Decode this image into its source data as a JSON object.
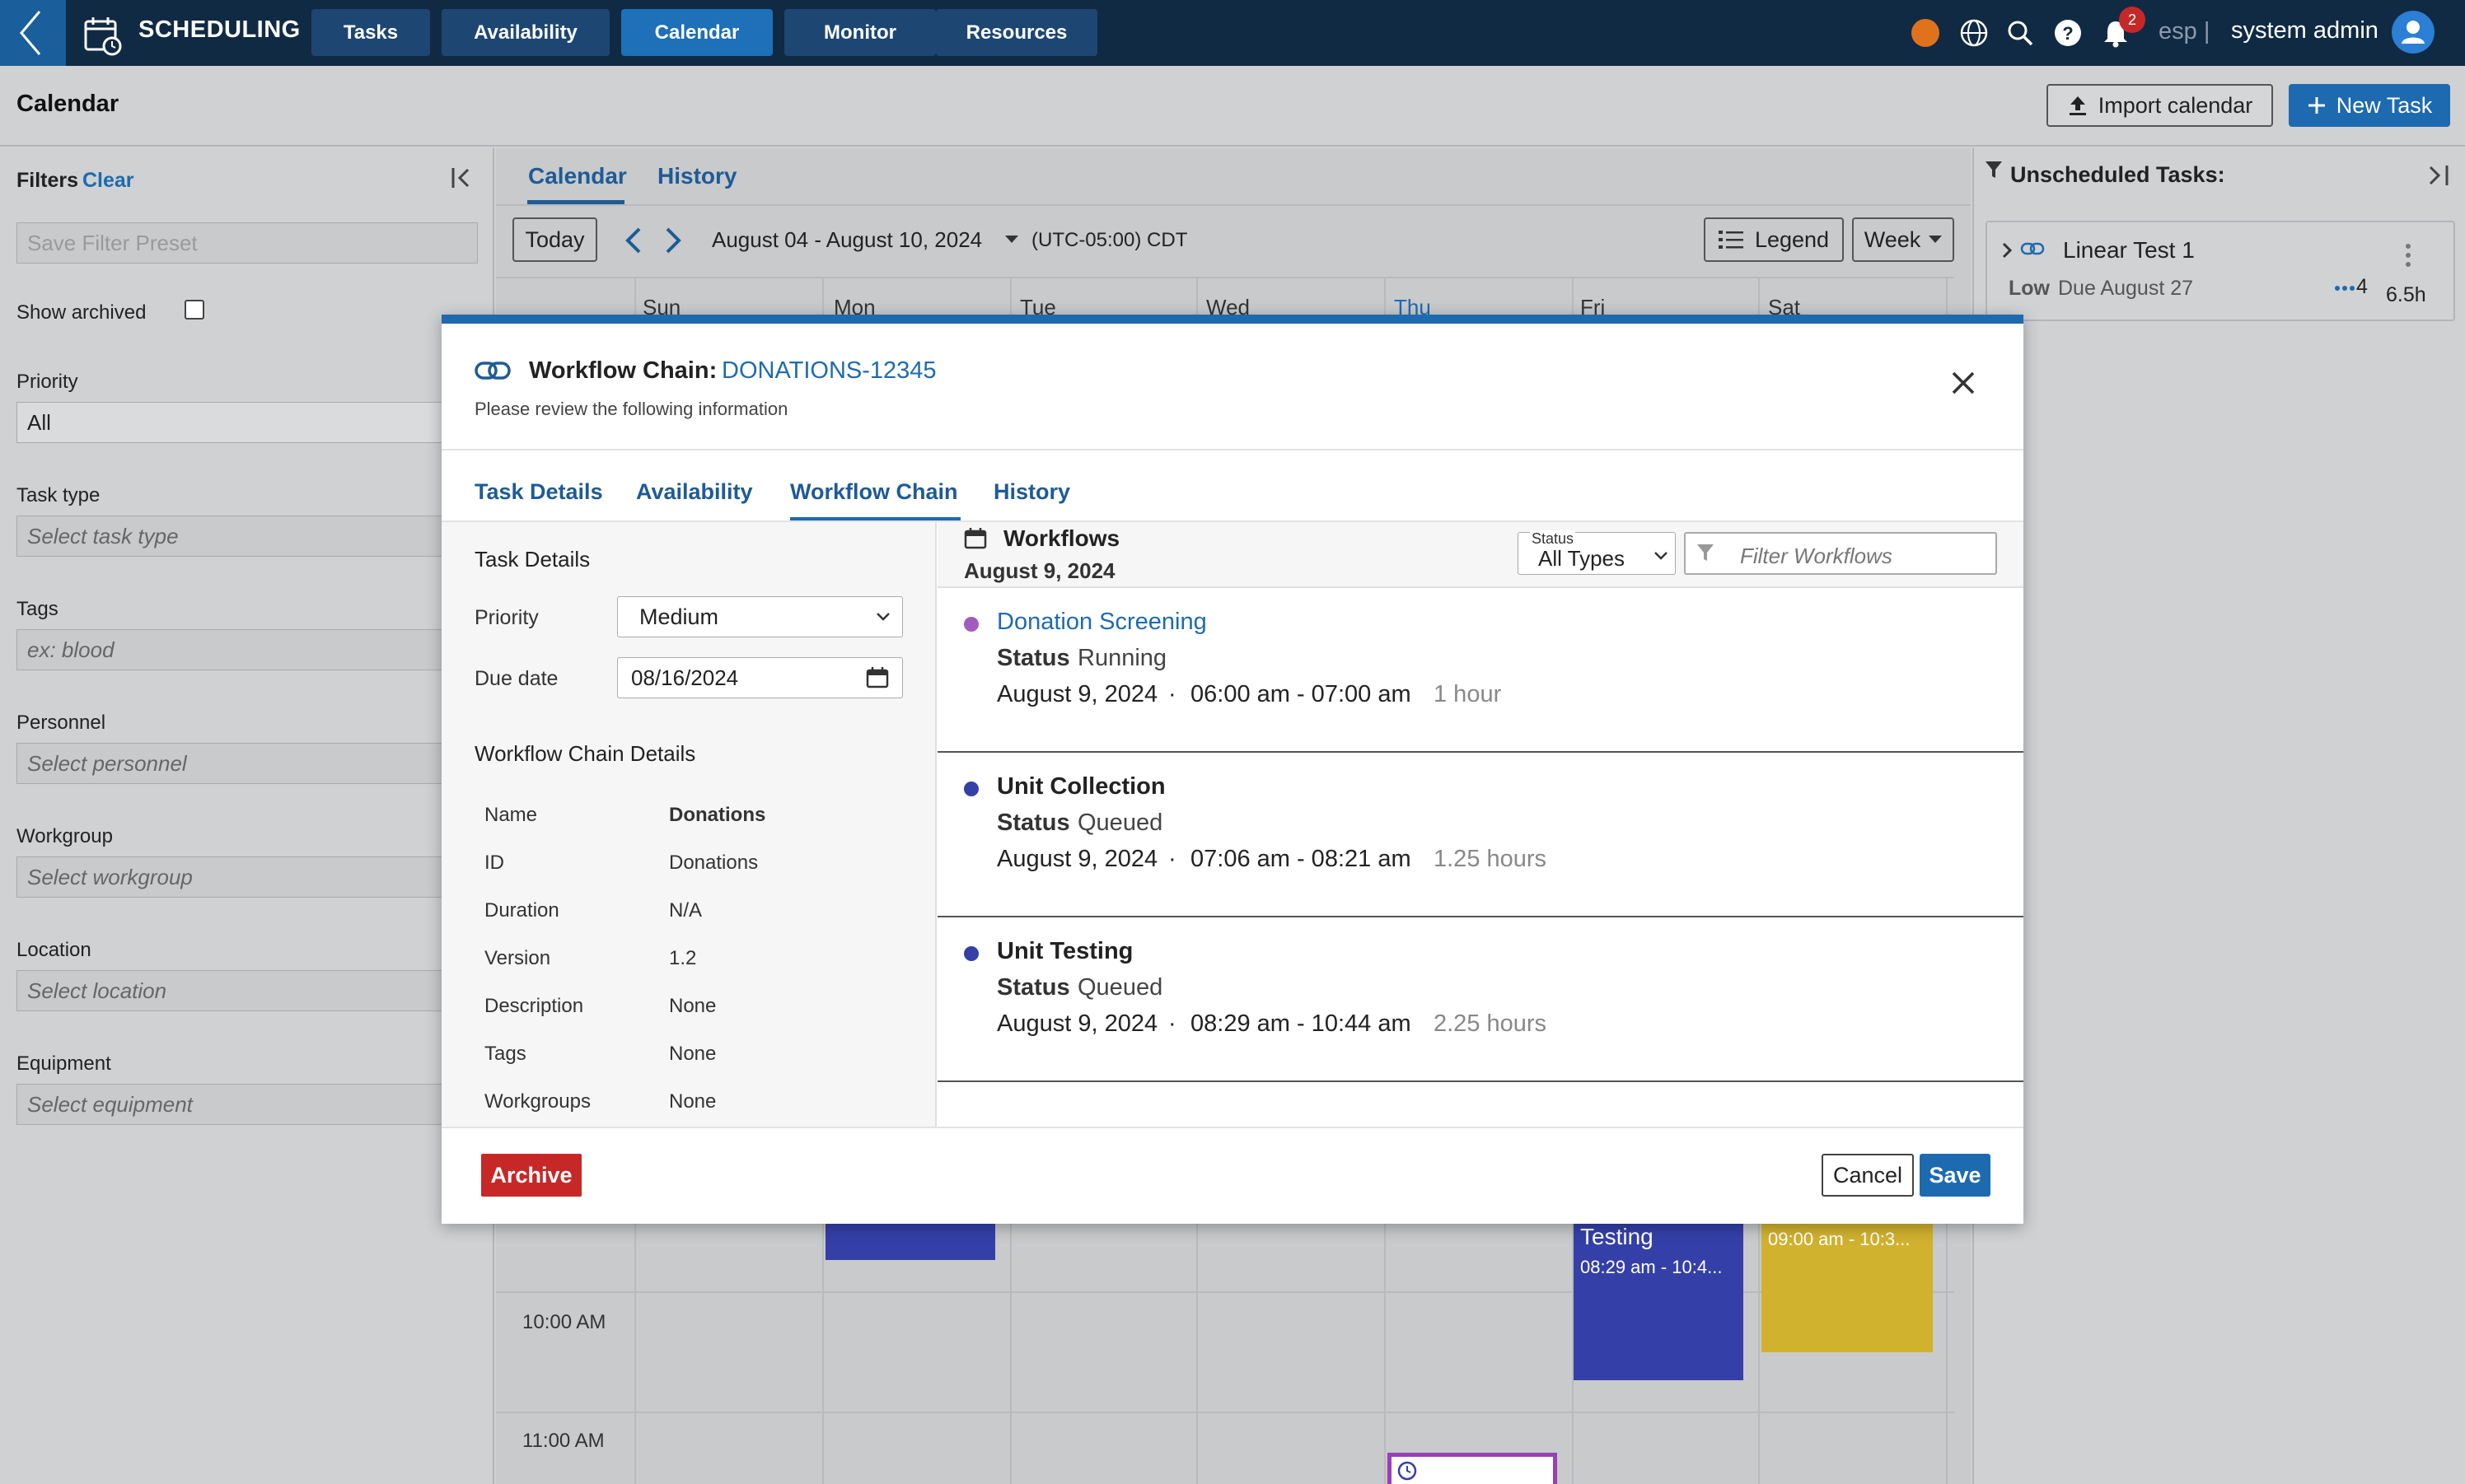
{
  "app": {
    "title": "SCHEDULING"
  },
  "nav": {
    "items": [
      {
        "label": "Tasks"
      },
      {
        "label": "Availability"
      },
      {
        "label": "Calendar",
        "active": true
      },
      {
        "label": "Monitor"
      },
      {
        "label": "Resources"
      }
    ]
  },
  "user": {
    "notifications": "2",
    "language": "esp |",
    "name": "system admin"
  },
  "page": {
    "title": "Calendar",
    "import_label": "Import calendar",
    "new_task_label": "New Task"
  },
  "filters": {
    "title": "Filters",
    "clear_label": "Clear",
    "preset_placeholder": "Save Filter Preset",
    "show_archived_label": "Show archived",
    "priority": {
      "label": "Priority",
      "value": "All"
    },
    "task_type": {
      "label": "Task type",
      "placeholder": "Select task type"
    },
    "tags": {
      "label": "Tags",
      "placeholder": "ex: blood"
    },
    "personnel": {
      "label": "Personnel",
      "placeholder": "Select personnel"
    },
    "workgroup": {
      "label": "Workgroup",
      "placeholder": "Select workgroup"
    },
    "location": {
      "label": "Location",
      "placeholder": "Select location"
    },
    "equipment": {
      "label": "Equipment",
      "placeholder": "Select equipment"
    }
  },
  "calendar": {
    "tabs": [
      "Calendar",
      "History"
    ],
    "today_label": "Today",
    "range": "August 04 - August 10, 2024",
    "timezone": "(UTC-05:00) CDT",
    "legend_label": "Legend",
    "view_label": "Week",
    "days": [
      "Sun",
      "Mon",
      "Tue",
      "Wed",
      "Thu",
      "Fri",
      "Sat"
    ],
    "hours": [
      "10:00 AM",
      "11:00 AM"
    ],
    "events": [
      {
        "title": "Testing",
        "time": "08:29 am - 10:4...",
        "color": "#3440a8"
      },
      {
        "title": "",
        "time": "09:00 am - 10:3...",
        "color": "#d1b22f"
      }
    ]
  },
  "unscheduled": {
    "title": "Unscheduled Tasks:",
    "tasks": [
      {
        "name": "Linear Test 1",
        "priority": "Low",
        "due": "Due August 27",
        "links": "4",
        "duration": "6.5h"
      }
    ]
  },
  "modal": {
    "title_prefix": "Workflow Chain:",
    "title_id": "DONATIONS-12345",
    "subtitle": "Please review the following information",
    "tabs": [
      "Task Details",
      "Availability",
      "Workflow Chain",
      "History"
    ],
    "active_tab": "Workflow Chain",
    "task_details": {
      "heading": "Task Details",
      "priority_label": "Priority",
      "priority_value": "Medium",
      "due_label": "Due date",
      "due_value": "08/16/2024"
    },
    "chain_details": {
      "heading": "Workflow Chain Details",
      "rows": [
        {
          "label": "Name",
          "value": "Donations"
        },
        {
          "label": "ID",
          "value": "Donations"
        },
        {
          "label": "Duration",
          "value": "N/A"
        },
        {
          "label": "Version",
          "value": "1.2"
        },
        {
          "label": "Description",
          "value": "None"
        },
        {
          "label": "Tags",
          "value": "None"
        },
        {
          "label": "Workgroups",
          "value": "None"
        }
      ]
    },
    "workflows": {
      "heading": "Workflows",
      "date": "August 9, 2024",
      "status_label": "Status",
      "status_value": "All Types",
      "filter_placeholder": "Filter Workflows",
      "items": [
        {
          "name": "Donation Screening",
          "status_label": "Status",
          "status": "Running",
          "date": "August 9, 2024",
          "sep": "·",
          "time": "06:00 am - 07:00 am",
          "duration": "1 hour",
          "color": "#a35bbf",
          "link": true
        },
        {
          "name": "Unit Collection",
          "status_label": "Status",
          "status": "Queued",
          "date": "August 9, 2024",
          "sep": "·",
          "time": "07:06 am - 08:21 am",
          "duration": "1.25 hours",
          "color": "#3440a8",
          "link": false
        },
        {
          "name": "Unit Testing",
          "status_label": "Status",
          "status": "Queued",
          "date": "August 9, 2024",
          "sep": "·",
          "time": "08:29 am - 10:44 am",
          "duration": "2.25 hours",
          "color": "#3440a8",
          "link": false
        }
      ]
    },
    "archive_label": "Archive",
    "cancel_label": "Cancel",
    "save_label": "Save"
  },
  "colors": {
    "accent": "#1e6ab0",
    "navbar": "#102a43",
    "danger": "#c62828",
    "orange": "#e0721b"
  }
}
